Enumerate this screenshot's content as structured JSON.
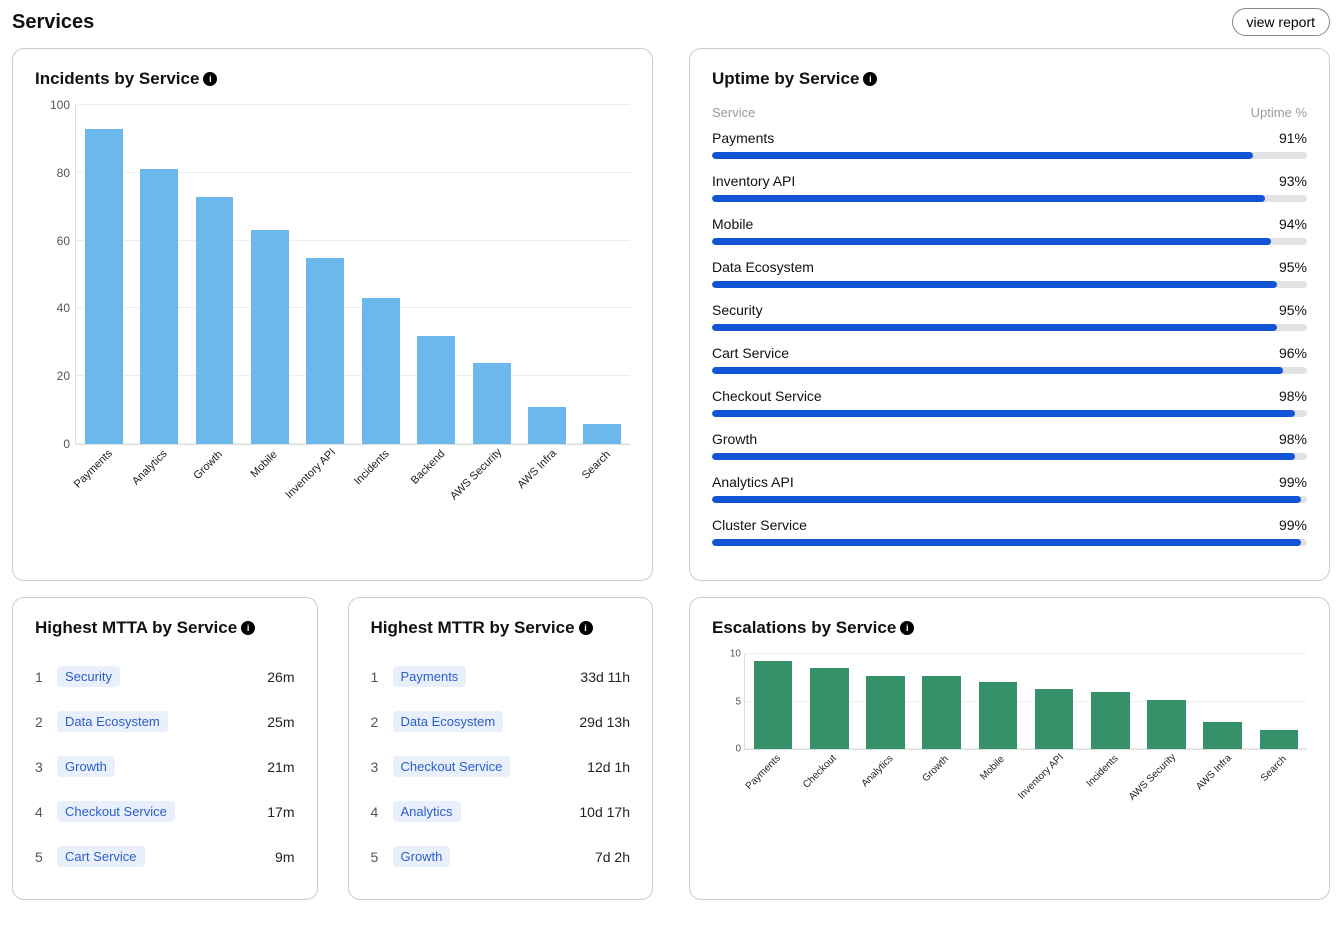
{
  "header": {
    "title": "Services",
    "view_report_label": "view report"
  },
  "panels": {
    "incidents": {
      "title": "Incidents by Service"
    },
    "uptime": {
      "title": "Uptime by Service",
      "col_service": "Service",
      "col_uptime": "Uptime %"
    },
    "mtta": {
      "title": "Highest MTTA by Service"
    },
    "mttr": {
      "title": "Highest MTTR by Service"
    },
    "escalations": {
      "title": "Escalations by Service"
    }
  },
  "chart_data": [
    {
      "id": "incidents",
      "type": "bar",
      "title": "Incidents by Service",
      "categories": [
        "Payments",
        "Analytics",
        "Growth",
        "Mobile",
        "Inventory API",
        "Incidents",
        "Backend",
        "AWS Security",
        "AWS Infra",
        "Search"
      ],
      "values": [
        93,
        81,
        73,
        63,
        55,
        43,
        32,
        24,
        11,
        6
      ],
      "ylim": [
        0,
        100
      ],
      "yticks": [
        0,
        20,
        40,
        60,
        80,
        100
      ],
      "color": "#6cb7eb"
    },
    {
      "id": "uptime",
      "type": "bar",
      "title": "Uptime by Service",
      "orientation": "horizontal",
      "categories": [
        "Payments",
        "Inventory API",
        "Mobile",
        "Data Ecosystem",
        "Security",
        "Cart Service",
        "Checkout Service",
        "Growth",
        "Analytics API",
        "Cluster Service"
      ],
      "values": [
        91,
        93,
        94,
        95,
        95,
        96,
        98,
        98,
        99,
        99
      ],
      "value_suffix": "%",
      "ylim": [
        0,
        100
      ],
      "color": "#1154d6"
    },
    {
      "id": "escalations",
      "type": "bar",
      "title": "Escalations by Service",
      "categories": [
        "Payments",
        "Checkout",
        "Analytics",
        "Growth",
        "Mobile",
        "Inventory API",
        "Incidents",
        "AWS Security",
        "AWS Infra",
        "Search"
      ],
      "values": [
        9.3,
        8.5,
        7.7,
        7.7,
        7.1,
        6.3,
        6.0,
        5.2,
        2.8,
        2.0
      ],
      "ylim": [
        0,
        10
      ],
      "yticks": [
        0,
        5,
        10
      ],
      "color": "#349169"
    }
  ],
  "mtta": [
    {
      "rank": 1,
      "service": "Security",
      "value": "26m"
    },
    {
      "rank": 2,
      "service": "Data Ecosystem",
      "value": "25m"
    },
    {
      "rank": 3,
      "service": "Growth",
      "value": "21m"
    },
    {
      "rank": 4,
      "service": "Checkout Service",
      "value": "17m"
    },
    {
      "rank": 5,
      "service": "Cart Service",
      "value": "9m"
    }
  ],
  "mttr": [
    {
      "rank": 1,
      "service": "Payments",
      "value": "33d 11h"
    },
    {
      "rank": 2,
      "service": "Data Ecosystem",
      "value": "29d 13h"
    },
    {
      "rank": 3,
      "service": "Checkout Service",
      "value": "12d 1h"
    },
    {
      "rank": 4,
      "service": "Analytics",
      "value": "10d 17h"
    },
    {
      "rank": 5,
      "service": "Growth",
      "value": "7d 2h"
    }
  ]
}
